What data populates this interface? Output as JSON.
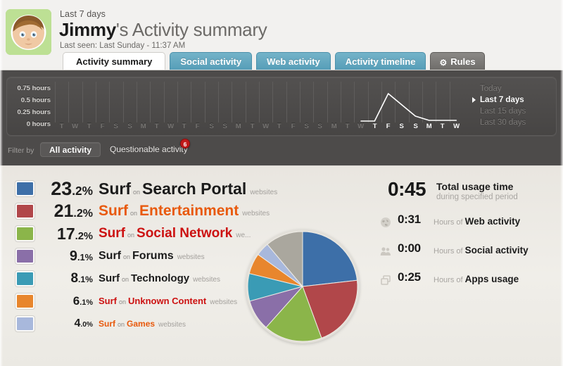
{
  "header": {
    "period_label": "Last 7 days",
    "user_name": "Jimmy",
    "title_rest": "'s Activity summary",
    "last_seen": "Last seen: Last Sunday - 11:37 AM",
    "avatar_alt": "boy-avatar"
  },
  "tabs": [
    {
      "label": "Activity summary",
      "active": true,
      "style": "white"
    },
    {
      "label": "Social activity",
      "active": false,
      "style": "blue"
    },
    {
      "label": "Web activity",
      "active": false,
      "style": "blue"
    },
    {
      "label": "Activity timeline",
      "active": false,
      "style": "blue"
    },
    {
      "label": "Rules",
      "active": false,
      "style": "grey",
      "icon": "gear-icon"
    }
  ],
  "graph": {
    "y_labels": [
      "0.75 hours",
      "0.5 hours",
      "0.25 hours",
      "0 hours"
    ],
    "x_labels": [
      "T",
      "W",
      "T",
      "F",
      "S",
      "S",
      "M",
      "T",
      "W",
      "T",
      "F",
      "S",
      "S",
      "M",
      "T",
      "W",
      "T",
      "F",
      "S",
      "S",
      "M",
      "T",
      "W",
      "T",
      "F",
      "S",
      "S",
      "M",
      "T",
      "W"
    ],
    "highlight_from_index": 23,
    "ranges": [
      {
        "label": "Today",
        "selected": false
      },
      {
        "label": "Last 7 days",
        "selected": true
      },
      {
        "label": "Last 15 days",
        "selected": false
      },
      {
        "label": "Last 30 days",
        "selected": false
      }
    ]
  },
  "filter": {
    "label": "Filter by",
    "all_label": "All activity",
    "questionable_label": "Questionable activity",
    "badge": "6"
  },
  "chart_data": {
    "type": "pie",
    "title": "Activity summary by category",
    "categories": [
      "Surf on Search Portal websites",
      "Surf on Entertainment websites",
      "Surf on Social Network we...",
      "Surf on Forums websites",
      "Surf on Technology websites",
      "Surf on Unknown Content websites",
      "Surf on Games websites"
    ],
    "values": [
      23.2,
      21.2,
      17.2,
      9.1,
      8.1,
      6.1,
      4.0
    ],
    "colors": [
      "#3d6fa8",
      "#b1474a",
      "#8bb54a",
      "#8a6fa8",
      "#3a9bb5",
      "#e8862d",
      "#a8b8dc"
    ],
    "other_color": "#aaa79e",
    "other_value": 11.1,
    "legend_position": "left",
    "ylabel": "",
    "xlabel": ""
  },
  "legend": [
    {
      "pct_main": "23",
      "pct_dec": ".2%",
      "color": "#3d6fa8",
      "verb": "Surf",
      "on": "on",
      "cat": "Search Portal",
      "suffix": "websites",
      "size": 23,
      "verb_color": "#1b1b1b",
      "cat_color": "#1b1b1b"
    },
    {
      "pct_main": "21",
      "pct_dec": ".2%",
      "color": "#b1474a",
      "verb": "Surf",
      "on": "on",
      "cat": "Entertainment",
      "suffix": "websites",
      "size": 21,
      "verb_color": "#e8590c",
      "cat_color": "#e8590c"
    },
    {
      "pct_main": "17",
      "pct_dec": ".2%",
      "color": "#8bb54a",
      "verb": "Surf",
      "on": "on",
      "cat": "Social Network",
      "suffix": "we...",
      "size": 19,
      "verb_color": "#cc1111",
      "cat_color": "#cc1111"
    },
    {
      "pct_main": "9",
      "pct_dec": ".1%",
      "color": "#8a6fa8",
      "verb": "Surf",
      "on": "on",
      "cat": "Forums",
      "suffix": "websites",
      "size": 16,
      "verb_color": "#1b1b1b",
      "cat_color": "#1b1b1b"
    },
    {
      "pct_main": "8",
      "pct_dec": ".1%",
      "color": "#3a9bb5",
      "verb": "Surf",
      "on": "on",
      "cat": "Technology",
      "suffix": "websites",
      "size": 15,
      "verb_color": "#1b1b1b",
      "cat_color": "#1b1b1b"
    },
    {
      "pct_main": "6",
      "pct_dec": ".1%",
      "color": "#e8862d",
      "verb": "Surf",
      "on": "on",
      "cat": "Unknown Content",
      "suffix": "websites",
      "size": 13,
      "verb_color": "#cc1111",
      "cat_color": "#cc1111"
    },
    {
      "pct_main": "4",
      "pct_dec": ".0%",
      "color": "#a8b8dc",
      "verb": "Surf",
      "on": "on",
      "cat": "Games",
      "suffix": "websites",
      "size": 12,
      "verb_color": "#e8590c",
      "cat_color": "#e8590c"
    }
  ],
  "stats": {
    "total_value": "0:45",
    "total_title": "Total usage time",
    "total_sub": "during specified period",
    "rows": [
      {
        "icon": "globe-icon",
        "value": "0:31",
        "prefix": "Hours of",
        "label": "Web activity"
      },
      {
        "icon": "people-icon",
        "value": "0:00",
        "prefix": "Hours of",
        "label": "Social activity"
      },
      {
        "icon": "windows-icon",
        "value": "0:25",
        "prefix": "Hours of",
        "label": "Apps usage"
      }
    ]
  }
}
